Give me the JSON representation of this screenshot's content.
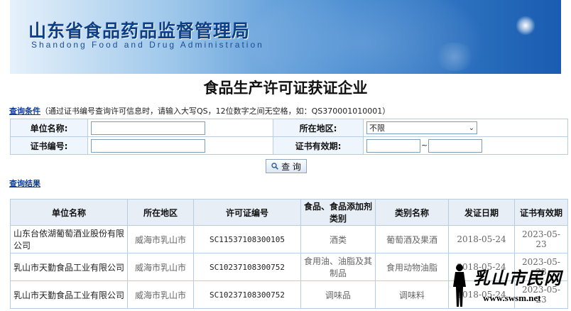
{
  "header": {
    "title_cn": "山东省食品药品监督管理局",
    "title_en": "Shandong Food and Drug Administration"
  },
  "page_title": "食品生产许可证获证企业",
  "query_conditions": {
    "label": "查询条件",
    "hint": "（通过证书编号查询许可信息时，请输入大写QS，12位数字之间无空格，如：QS370001010001）"
  },
  "search_form": {
    "company_name_label": "单位名称:",
    "company_name_value": "",
    "region_label": "所在地区:",
    "region_value": "不限",
    "cert_no_label": "证书编号:",
    "cert_no_value": "",
    "validity_label": "证书有效期:",
    "validity_from": "",
    "validity_sep": "~",
    "validity_to": "",
    "query_button": "查 询"
  },
  "results_label": "查询结果",
  "table": {
    "headers": [
      "单位名称",
      "所在地区",
      "许可证编号",
      "食品、食品添加剂类别",
      "类别名称",
      "发证日期",
      "证书有效期"
    ],
    "rows": [
      {
        "company": "山东台依湖葡萄酒业股份有限公司",
        "region": "威海市乳山市",
        "license": "SC11537108300105",
        "category": "酒类",
        "category_name": "葡萄酒及果酒",
        "issue_date": "2018-05-24",
        "valid_until": "2023-05-23"
      },
      {
        "company": "乳山市天勤食品工业有限公司",
        "region": "威海市乳山市",
        "license": "SC10237108300752",
        "category": "食用油、油脂及其制品",
        "category_name": "食用动物油脂",
        "issue_date": "2018-05-24",
        "valid_until": "2023-05-23"
      },
      {
        "company": "乳山市天勤食品工业有限公司",
        "region": "威海市乳山市",
        "license": "SC10237108300752",
        "category": "调味品",
        "category_name": "调味料",
        "issue_date": "2018-05-24",
        "valid_until": "2023-05-23"
      }
    ]
  },
  "watermark": {
    "text_cn": "乳山市民网",
    "url": "www.swsm.net"
  }
}
